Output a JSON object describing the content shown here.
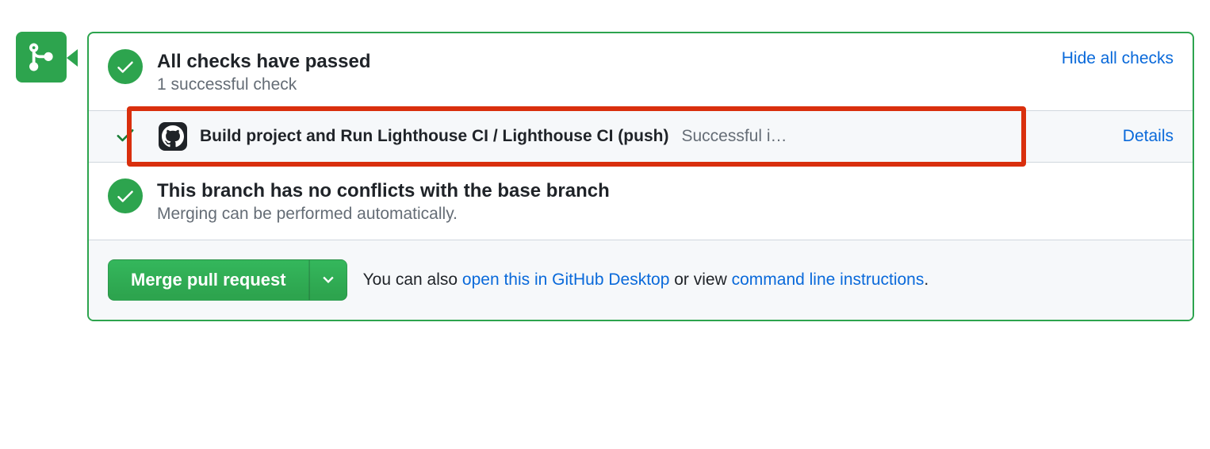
{
  "checks": {
    "title": "All checks have passed",
    "subtitle": "1 successful check",
    "toggle": "Hide all checks",
    "items": [
      {
        "name": "Build project and Run Lighthouse CI / Lighthouse CI (push)",
        "status_text": "Successful i…",
        "details_label": "Details"
      }
    ]
  },
  "conflicts": {
    "title": "This branch has no conflicts with the base branch",
    "subtitle": "Merging can be performed automatically."
  },
  "merge": {
    "button_label": "Merge pull request",
    "note_prefix": "You can also ",
    "desktop_link": "open this in GitHub Desktop",
    "note_middle": " or view ",
    "cli_link": "command line instructions",
    "note_suffix": "."
  }
}
